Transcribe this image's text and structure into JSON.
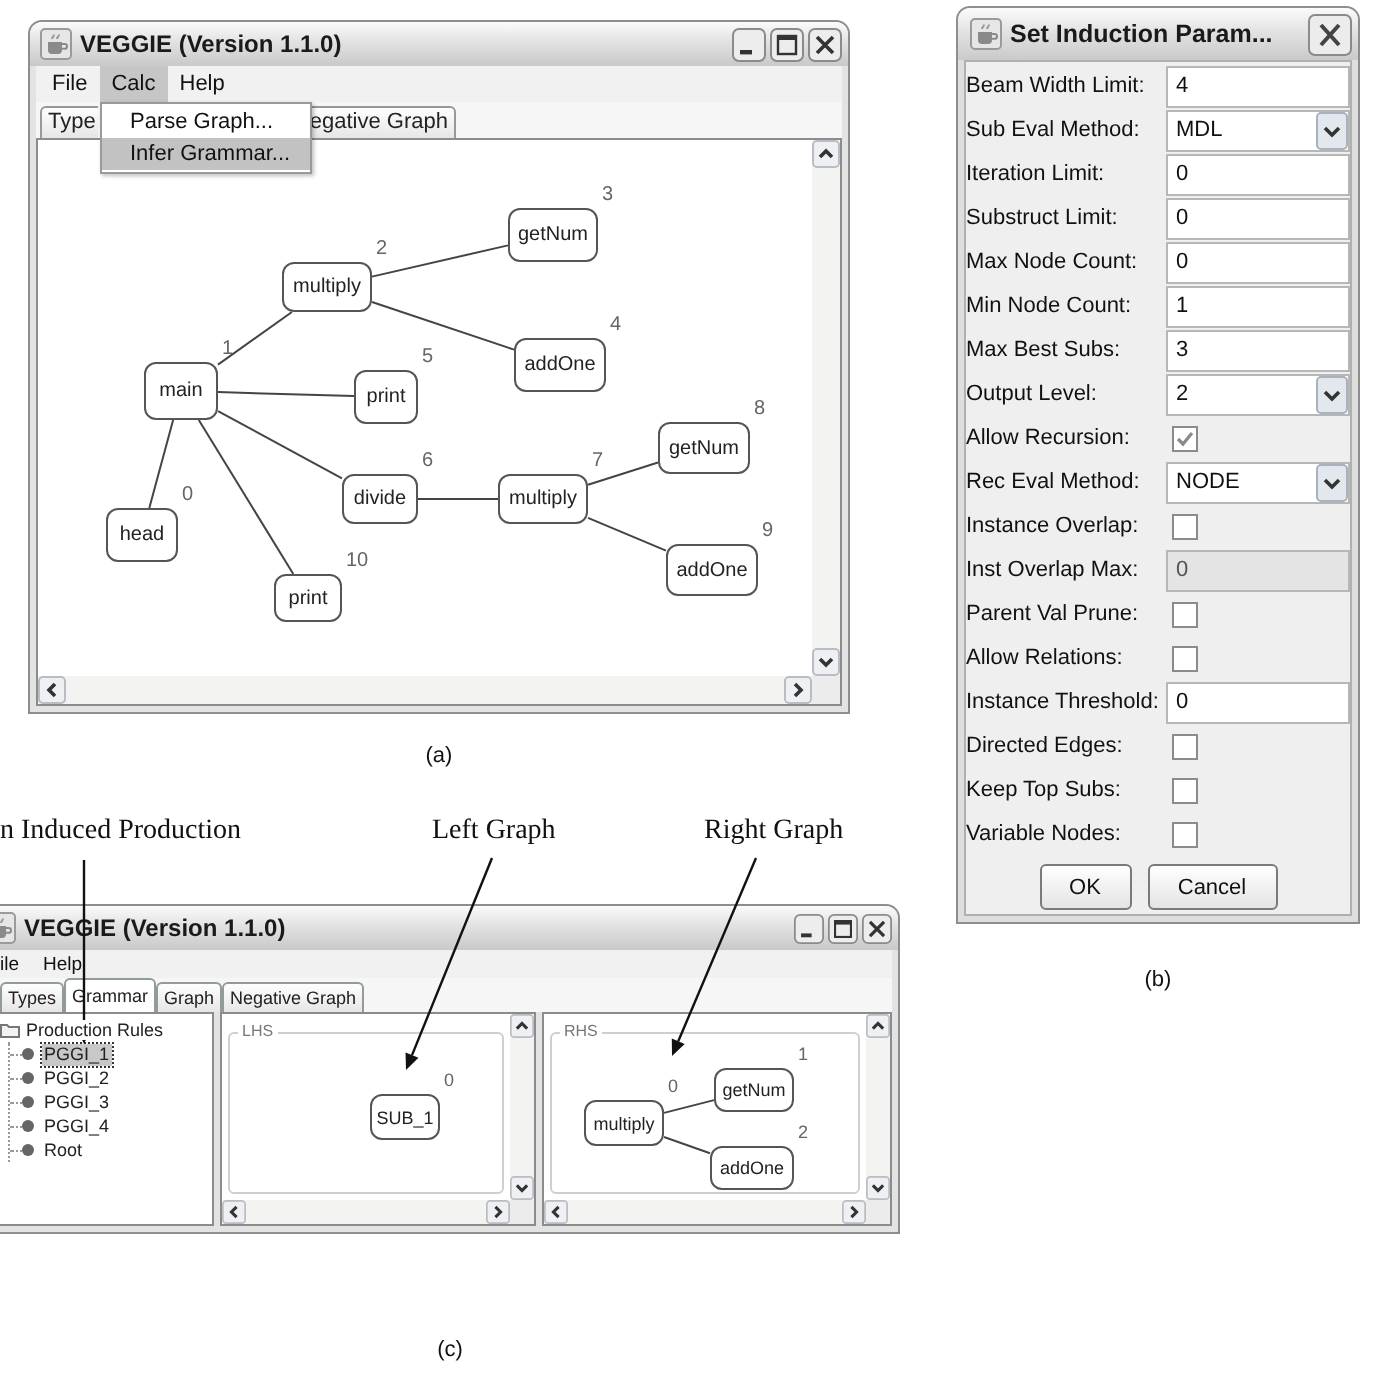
{
  "figure_a": {
    "window": {
      "title": "VEGGIE (Version 1.1.0)"
    },
    "menu": [
      {
        "label": "File",
        "selected": false
      },
      {
        "label": "Calc",
        "selected": true
      },
      {
        "label": "Help",
        "selected": false
      }
    ],
    "open_menu": [
      {
        "label": "Parse Graph...",
        "selected": false
      },
      {
        "label": "Infer Grammar...",
        "selected": true
      }
    ],
    "tabs": [
      {
        "label": "Type",
        "selected": false
      },
      {
        "label": "egative Graph",
        "selected": false
      }
    ],
    "graph": {
      "nodes": [
        {
          "label": "head",
          "number": "0",
          "children": [
            {
              "label": "main",
              "number": "1",
              "children": [
                {
                  "label": "multiply",
                  "number": "2",
                  "children": [
                    {
                      "label": "getNum",
                      "number": "3"
                    },
                    {
                      "label": "addOne",
                      "number": "4"
                    }
                  ]
                },
                {
                  "label": "print",
                  "number": "5"
                },
                {
                  "label": "divide",
                  "number": "6",
                  "children": [
                    {
                      "label": "multiply",
                      "number": "7",
                      "children": [
                        {
                          "label": "getNum",
                          "number": "8"
                        },
                        {
                          "label": "addOne",
                          "number": "9"
                        }
                      ]
                    }
                  ]
                },
                {
                  "label": "print",
                  "number": "10"
                }
              ]
            }
          ]
        }
      ]
    },
    "caption": "(a)"
  },
  "figure_b": {
    "dialog": {
      "title": "Set Induction Param..."
    },
    "fields": [
      {
        "label": "Beam Width Limit:",
        "kind": "text",
        "value": "4",
        "disabled": false
      },
      {
        "label": "Sub Eval Method:",
        "kind": "combo",
        "value": "MDL",
        "disabled": false
      },
      {
        "label": "Iteration Limit:",
        "kind": "text",
        "value": "0",
        "disabled": false
      },
      {
        "label": "Substruct Limit:",
        "kind": "text",
        "value": "0",
        "disabled": false
      },
      {
        "label": "Max Node Count:",
        "kind": "text",
        "value": "0",
        "disabled": false
      },
      {
        "label": "Min Node Count:",
        "kind": "text",
        "value": "1",
        "disabled": false
      },
      {
        "label": "Max Best Subs:",
        "kind": "text",
        "value": "3",
        "disabled": false
      },
      {
        "label": "Output Level:",
        "kind": "combo",
        "value": "2",
        "disabled": false
      },
      {
        "label": "Allow Recursion:",
        "kind": "checkbox",
        "checked": true,
        "disabled": false
      },
      {
        "label": "Rec Eval Method:",
        "kind": "combo",
        "value": "NODE",
        "disabled": false
      },
      {
        "label": "Instance Overlap:",
        "kind": "checkbox",
        "checked": false,
        "disabled": false
      },
      {
        "label": "Inst Overlap Max:",
        "kind": "text",
        "value": "0",
        "disabled": true
      },
      {
        "label": "Parent Val Prune:",
        "kind": "checkbox",
        "checked": false,
        "disabled": false
      },
      {
        "label": "Allow Relations:",
        "kind": "checkbox",
        "checked": false,
        "disabled": false
      },
      {
        "label": "Instance Threshold:",
        "kind": "text",
        "value": "0",
        "disabled": false
      },
      {
        "label": "Directed Edges:",
        "kind": "checkbox",
        "checked": false,
        "disabled": false
      },
      {
        "label": "Keep Top Subs:",
        "kind": "checkbox",
        "checked": false,
        "disabled": false
      },
      {
        "label": "Variable Nodes:",
        "kind": "checkbox",
        "checked": false,
        "disabled": false
      }
    ],
    "buttons": [
      "OK",
      "Cancel"
    ],
    "caption": "(b)"
  },
  "figure_c": {
    "annotations": [
      "n Induced Production",
      "Left Graph",
      "Right Graph"
    ],
    "window": {
      "title": "VEGGIE (Version 1.1.0)"
    },
    "menu": [
      "ile",
      "Help"
    ],
    "tabs": [
      {
        "label": "Types",
        "selected": false
      },
      {
        "label": "Grammar",
        "selected": true
      },
      {
        "label": "Graph",
        "selected": false
      },
      {
        "label": "Negative Graph",
        "selected": false
      }
    ],
    "tree": {
      "label": "Production Rules",
      "selected": false,
      "children": [
        {
          "label": "PGGI_1",
          "selected": true
        },
        {
          "label": "PGGI_2",
          "selected": false
        },
        {
          "label": "PGGI_3",
          "selected": false
        },
        {
          "label": "PGGI_4",
          "selected": false
        },
        {
          "label": "Root",
          "selected": false
        }
      ]
    },
    "lhs": {
      "title": "LHS",
      "nodes": [
        {
          "label": "SUB_1",
          "number": "0"
        }
      ]
    },
    "rhs": {
      "title": "RHS",
      "nodes": [
        {
          "label": "multiply",
          "number": "0",
          "children": [
            {
              "label": "getNum",
              "number": "1"
            },
            {
              "label": "addOne",
              "number": "2"
            }
          ]
        }
      ]
    },
    "caption": "(c)"
  }
}
